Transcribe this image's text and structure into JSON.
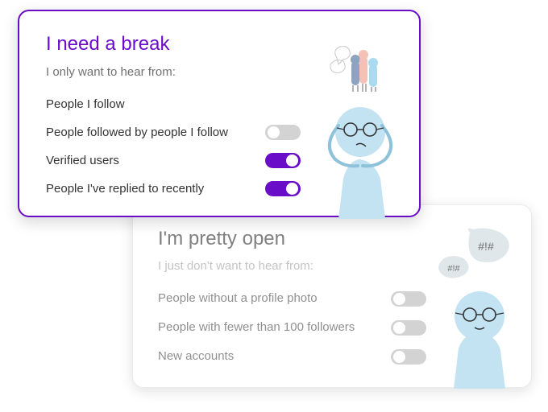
{
  "break_card": {
    "title": "I need a break",
    "subtitle": "I only want to hear from:",
    "rows": [
      {
        "label": "People I follow",
        "toggle": null
      },
      {
        "label": "People followed by people I follow",
        "toggle": "off"
      },
      {
        "label": "Verified users",
        "toggle": "on"
      },
      {
        "label": "People I've replied to recently",
        "toggle": "on"
      }
    ],
    "accent_color": "#6a0dc9"
  },
  "open_card": {
    "title": "I'm pretty open",
    "subtitle": "I just don't want to hear from:",
    "rows": [
      {
        "label": "People without a profile photo",
        "toggle": "off"
      },
      {
        "label": "People with fewer than 100 followers",
        "toggle": "off"
      },
      {
        "label": "New accounts",
        "toggle": "off"
      }
    ],
    "speech_bubbles": [
      "#!#",
      "#!#"
    ]
  },
  "illustration_colors": {
    "figure_blue": "#c3e3f2",
    "outline_blue": "#8ec2da"
  }
}
